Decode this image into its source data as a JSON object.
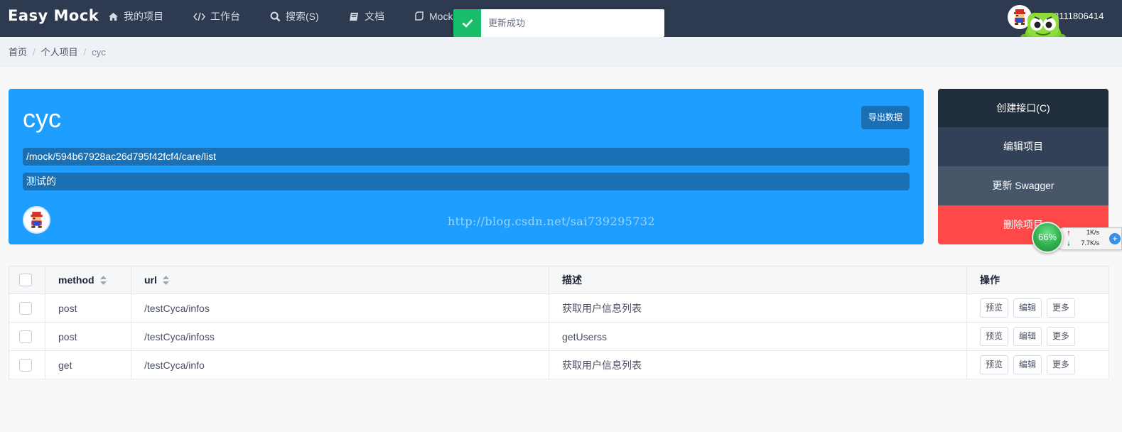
{
  "nav": {
    "brand": "Easy Mock",
    "items": [
      {
        "label": "我的项目",
        "icon": "home-icon"
      },
      {
        "label": "工作台",
        "icon": "code-icon"
      },
      {
        "label": "搜索(S)",
        "icon": "search-icon"
      },
      {
        "label": "文档",
        "icon": "book-icon"
      },
      {
        "label": "Mock",
        "icon": "mock-icon"
      }
    ],
    "user_name": "8111806414"
  },
  "toast": {
    "message": "更新成功",
    "color": "#19be6b"
  },
  "breadcrumb": [
    "首页",
    "个人项目",
    "cyc"
  ],
  "project": {
    "name": "cyc",
    "export_label": "导出数据",
    "url": "/mock/594b67928ac26d795f42fcf4/care/list",
    "description": "测试的",
    "watermark": "http://blog.csdn.net/sai739295732"
  },
  "actions": {
    "create": "创建接口(C)",
    "edit": "编辑项目",
    "swagger": "更新 Swagger",
    "delete": "删除项目"
  },
  "speed_widget": {
    "percent": "66%",
    "up": "1K/s",
    "down": "7.7K/s"
  },
  "table": {
    "headers": {
      "method": "method",
      "url": "url",
      "desc": "描述",
      "ops": "操作"
    },
    "rows": [
      {
        "method": "post",
        "url": "/testCyca/infos",
        "desc": "获取用户信息列表"
      },
      {
        "method": "post",
        "url": "/testCyca/infoss",
        "desc": "getUserss"
      },
      {
        "method": "get",
        "url": "/testCyca/info",
        "desc": "获取用户信息列表"
      }
    ],
    "op_labels": {
      "preview": "预览",
      "edit": "编辑",
      "more": "更多"
    }
  },
  "colors": {
    "nav_bg": "#2d3a4f",
    "hero_bg": "#1e9fff",
    "danger": "#ff4949"
  }
}
